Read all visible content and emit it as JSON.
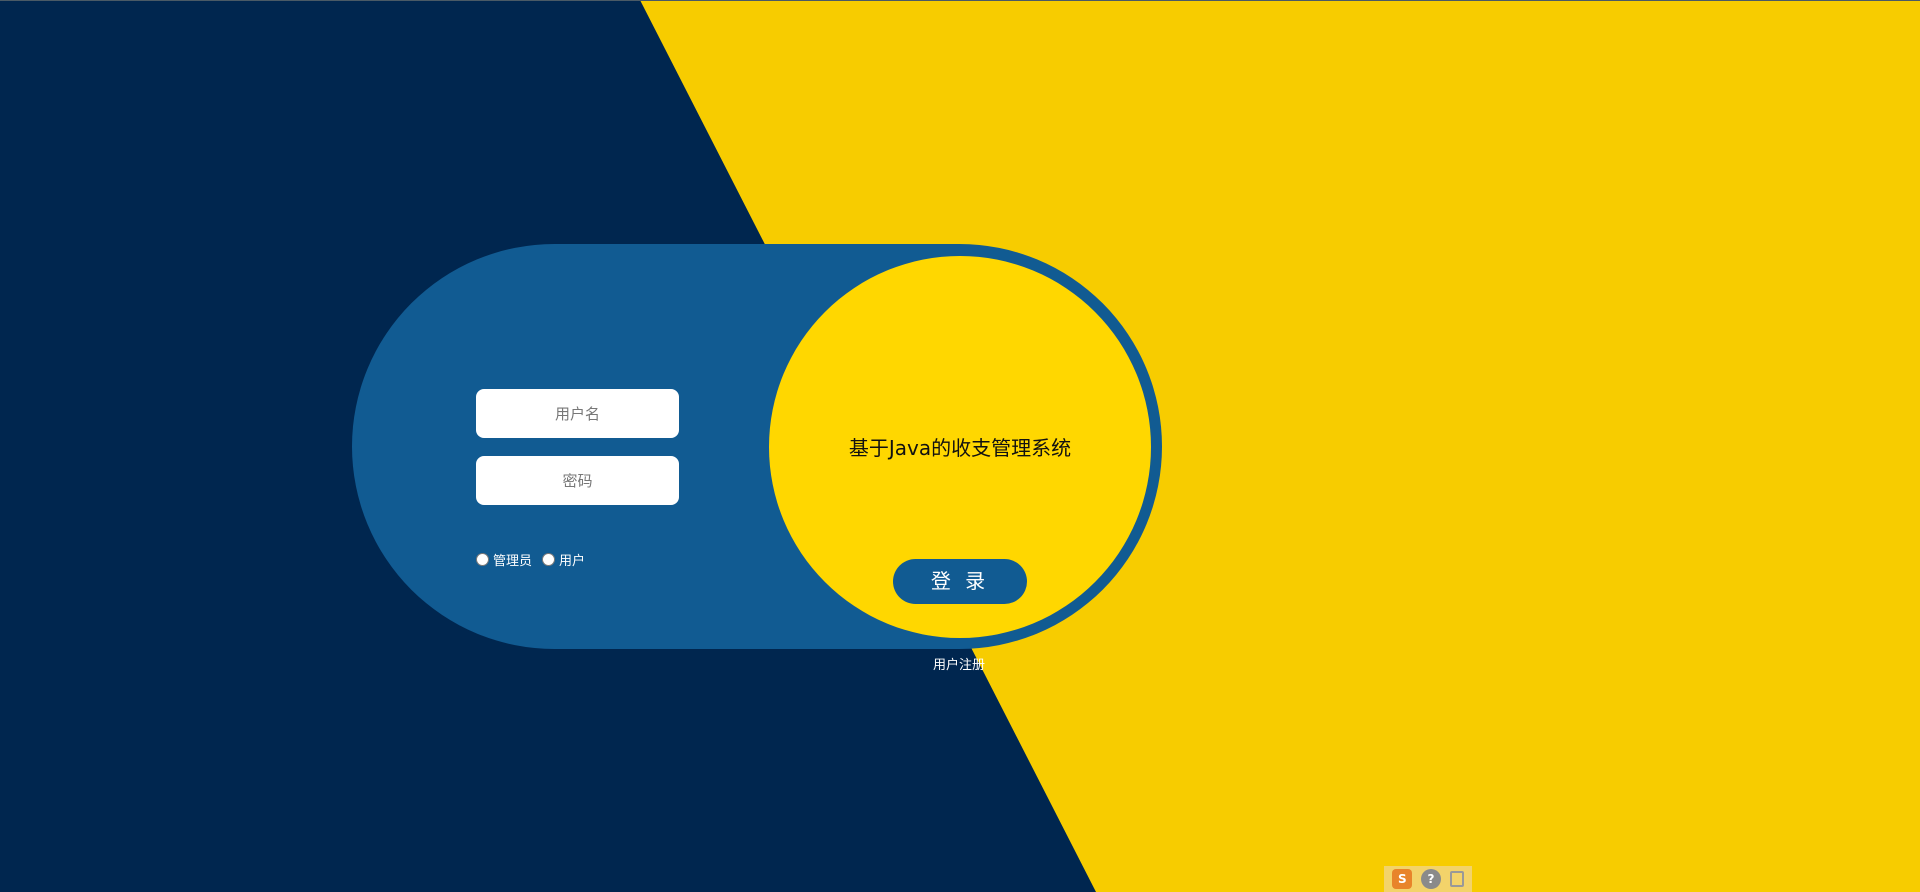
{
  "login": {
    "username_placeholder": "用户名",
    "password_placeholder": "密码",
    "roles": [
      {
        "label": "管理员"
      },
      {
        "label": "用户"
      }
    ],
    "title": "基于Java的收支管理系统",
    "login_label": "登 录",
    "register_label": "用户注册"
  },
  "toolbar": {
    "logo_glyph": "S",
    "help_glyph": "?"
  },
  "colors": {
    "navy": "#00264f",
    "yellow_bg": "#f7cc00",
    "panel_blue": "#115b92",
    "circle_yellow": "#ffd700"
  }
}
